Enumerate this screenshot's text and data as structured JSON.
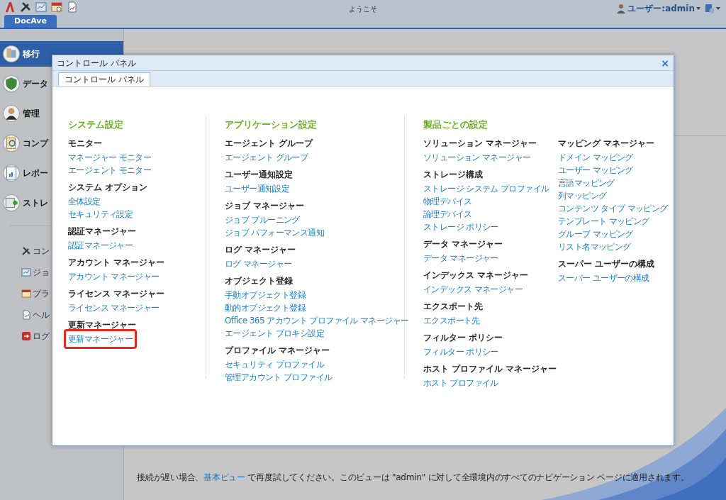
{
  "toolbar": {
    "title": "ようこそ",
    "user": "ユーザー:admin"
  },
  "app_tabs": [
    {
      "label": "DocAve",
      "selected": true
    }
  ],
  "sidebar": {
    "items": [
      {
        "label": "移行",
        "selected": true
      },
      {
        "label": "データ",
        "selected": false
      },
      {
        "label": "管理",
        "selected": false
      },
      {
        "label": "コンプ",
        "selected": false
      },
      {
        "label": "レポー",
        "selected": false
      },
      {
        "label": "ストレ",
        "selected": false
      }
    ],
    "links": [
      {
        "label": "コン"
      },
      {
        "label": "ジョ"
      },
      {
        "label": "プラ"
      },
      {
        "label": "ヘル"
      },
      {
        "label": "ログ"
      }
    ]
  },
  "dialog": {
    "title": "コントロール パネル",
    "close": "×",
    "tabs": [
      {
        "label": "コントロール パネル",
        "selected": true
      }
    ],
    "sections": [
      {
        "title": "システム設定",
        "columns": [
          [
            {
              "header": "モニター",
              "links": [
                {
                  "label": "マネージャー モニター",
                  "highlighted": false
                },
                {
                  "label": "エージェント モニター",
                  "highlighted": false
                }
              ]
            },
            {
              "header": "システム オプション",
              "links": [
                {
                  "label": "全体設定",
                  "highlighted": false
                },
                {
                  "label": "セキュリティ設定",
                  "highlighted": false
                }
              ]
            },
            {
              "header": "認証マネージャー",
              "links": [
                {
                  "label": "認証マネージャー",
                  "highlighted": false
                }
              ]
            },
            {
              "header": "アカウント マネージャー",
              "links": [
                {
                  "label": "アカウント マネージャー",
                  "highlighted": false
                }
              ]
            },
            {
              "header": "ライセンス マネージャー",
              "links": [
                {
                  "label": "ライセンス マネージャー",
                  "highlighted": false
                }
              ]
            },
            {
              "header": "更新マネージャー",
              "links": [
                {
                  "label": "更新マネージャー",
                  "highlighted": true
                }
              ]
            }
          ]
        ]
      },
      {
        "title": "アプリケーション設定",
        "columns": [
          [
            {
              "header": "エージェント グループ",
              "links": [
                {
                  "label": "エージェント グループ",
                  "highlighted": false
                }
              ]
            },
            {
              "header": "ユーザー通知設定",
              "links": [
                {
                  "label": "ユーザー通知設定",
                  "highlighted": false
                }
              ]
            },
            {
              "header": "ジョブ マネージャー",
              "links": [
                {
                  "label": "ジョブ プルーニング",
                  "highlighted": false
                },
                {
                  "label": "ジョブ パフォーマンス通知",
                  "highlighted": false
                }
              ]
            },
            {
              "header": "ログ マネージャー",
              "links": [
                {
                  "label": "ログ マネージャー",
                  "highlighted": false
                }
              ]
            },
            {
              "header": "オブジェクト登録",
              "links": [
                {
                  "label": "手動オブジェクト登録",
                  "highlighted": false
                },
                {
                  "label": "動的オブジェクト登録",
                  "highlighted": false
                },
                {
                  "label": "Office 365 アカウント プロファイル マネージャー",
                  "highlighted": false
                },
                {
                  "label": "エージェント プロキシ設定",
                  "highlighted": false
                }
              ]
            },
            {
              "header": "プロファイル マネージャー",
              "links": [
                {
                  "label": "セキュリティ プロファイル",
                  "highlighted": false
                },
                {
                  "label": "管理アカウント プロファイル",
                  "highlighted": false
                }
              ]
            }
          ]
        ]
      },
      {
        "title": "製品ごとの設定",
        "columns": [
          [
            {
              "header": "ソリューション マネージャー",
              "links": [
                {
                  "label": "ソリューション マネージャー",
                  "highlighted": false
                }
              ]
            },
            {
              "header": "ストレージ構成",
              "links": [
                {
                  "label": "ストレージ システム プロファイル",
                  "highlighted": false
                },
                {
                  "label": "物理デバイス",
                  "highlighted": false
                },
                {
                  "label": "論理デバイス",
                  "highlighted": false
                },
                {
                  "label": "ストレージ ポリシー",
                  "highlighted": false
                }
              ]
            },
            {
              "header": "データ マネージャー",
              "links": [
                {
                  "label": "データ マネージャー",
                  "highlighted": false
                }
              ]
            },
            {
              "header": "インデックス マネージャー",
              "links": [
                {
                  "label": "インデックス マネージャー",
                  "highlighted": false
                }
              ]
            },
            {
              "header": "エクスポート先",
              "links": [
                {
                  "label": "エクスポート先",
                  "highlighted": false
                }
              ]
            },
            {
              "header": "フィルター ポリシー",
              "links": [
                {
                  "label": "フィルター ポリシー",
                  "highlighted": false
                }
              ]
            },
            {
              "header": "ホスト プロファイル マネージャー",
              "links": [
                {
                  "label": "ホスト プロファイル",
                  "highlighted": false
                }
              ]
            }
          ],
          [
            {
              "header": "マッピング マネージャー",
              "links": [
                {
                  "label": "ドメイン マッピング",
                  "highlighted": false
                },
                {
                  "label": "ユーザー マッピング",
                  "highlighted": false
                },
                {
                  "label": "言語マッピング",
                  "highlighted": false
                },
                {
                  "label": "列マッピング",
                  "highlighted": false
                },
                {
                  "label": "コンテンツ タイプ マッピング",
                  "highlighted": false
                },
                {
                  "label": "テンプレート マッピング",
                  "highlighted": false
                },
                {
                  "label": "グループ マッピング",
                  "highlighted": false
                },
                {
                  "label": "リスト名マッピング",
                  "highlighted": false
                }
              ]
            },
            {
              "header": "スーパー ユーザーの構成",
              "links": [
                {
                  "label": "スーパー ユーザーの構成",
                  "highlighted": false
                }
              ]
            }
          ]
        ]
      }
    ]
  },
  "footer": {
    "before": "接続が遅い場合、",
    "link": "基本ビュー",
    "after": " で再度試してください。このビューは \"admin\" に対して全環境内のすべてのナビゲーション ページに適用されます。"
  }
}
